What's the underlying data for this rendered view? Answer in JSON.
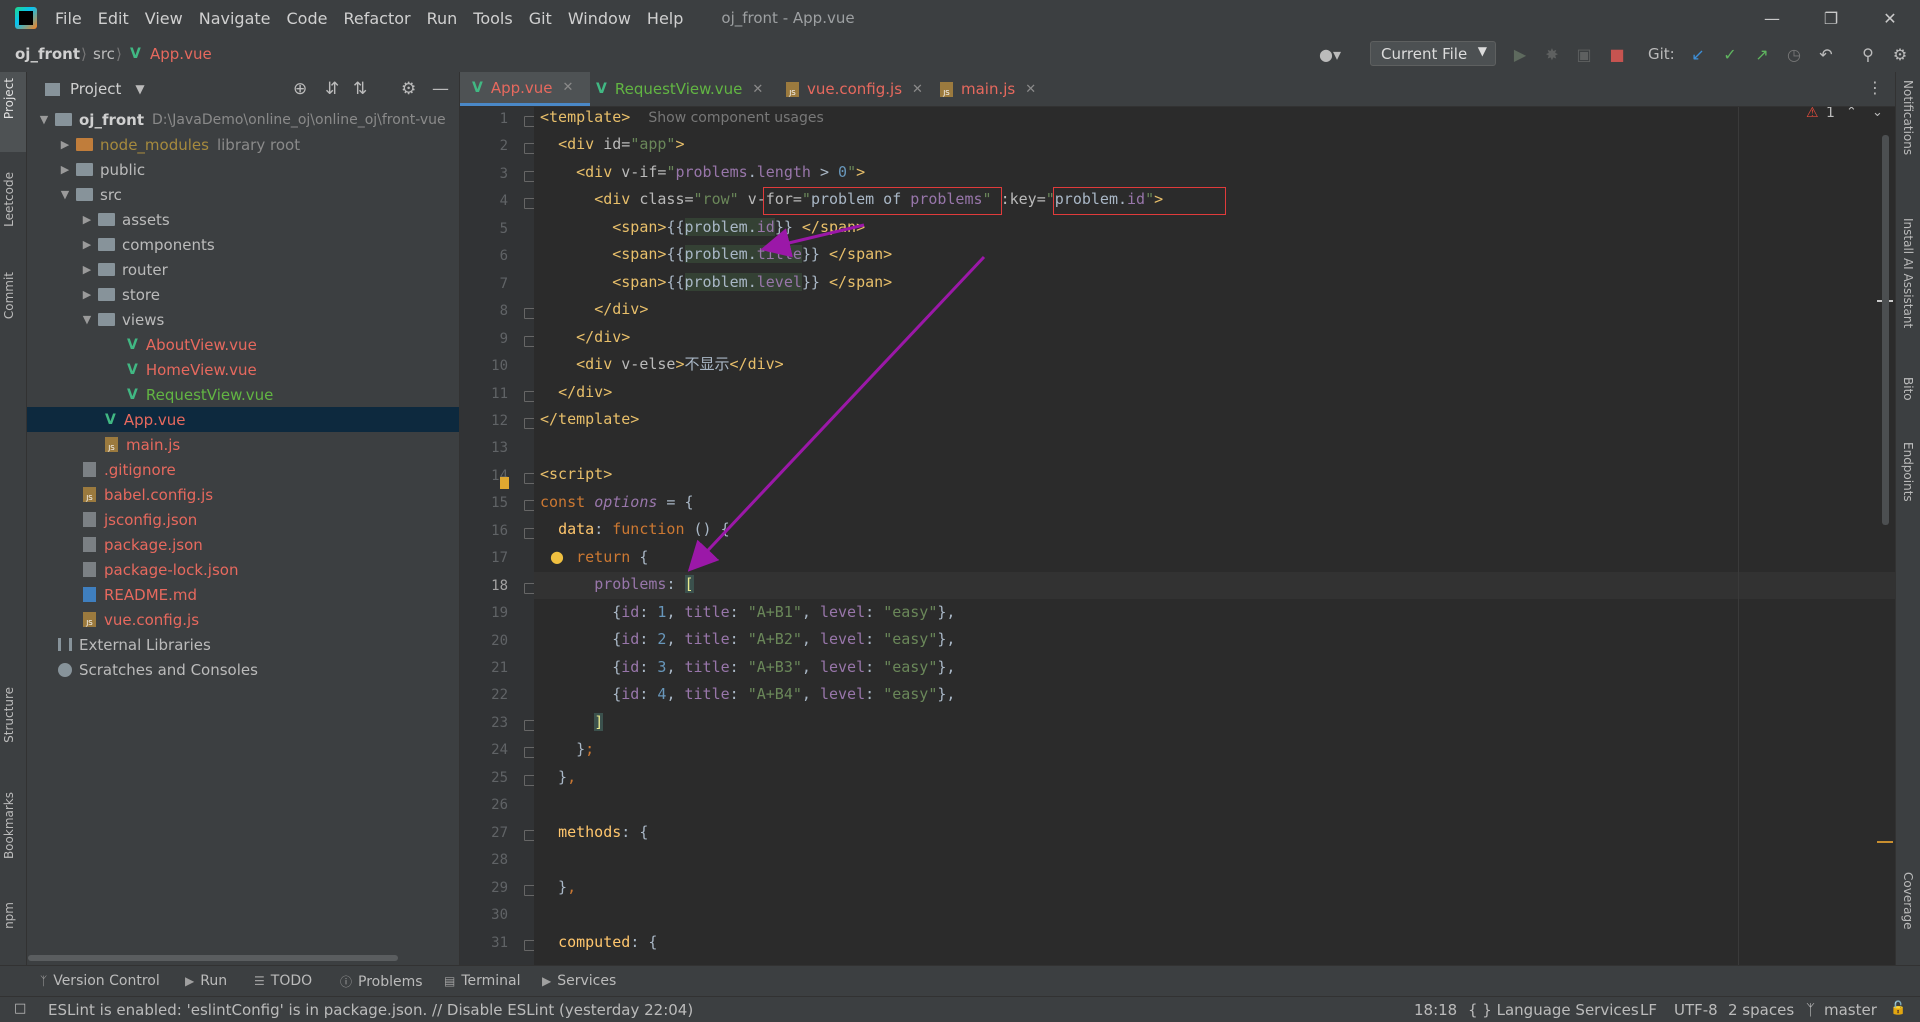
{
  "menu": [
    "File",
    "Edit",
    "View",
    "Navigate",
    "Code",
    "Refactor",
    "Run",
    "Tools",
    "Git",
    "Window",
    "Help"
  ],
  "window_title": "oj_front - App.vue",
  "breadcrumb": {
    "project": "oj_front",
    "folder": "src",
    "file": "App.vue"
  },
  "toolbar": {
    "run_config": "Current File",
    "git_label": "Git:"
  },
  "left_stripe": [
    "Project",
    "Leetcode",
    "Commit",
    "Structure",
    "Bookmarks",
    "npm"
  ],
  "right_stripe": [
    "Notifications",
    "Install AI Assistant",
    "Bito",
    "Endpoints",
    "Coverage"
  ],
  "project_panel": {
    "title": "Project",
    "tree": [
      {
        "label": "oj_front",
        "extra": "D:\\JavaDemo\\online_oj\\online_oj\\front-vue",
        "kind": "root"
      },
      {
        "label": "node_modules",
        "extra": "library root",
        "kind": "folder-lib"
      },
      {
        "label": "public",
        "kind": "folder"
      },
      {
        "label": "src",
        "kind": "folder-open"
      },
      {
        "label": "assets",
        "kind": "folder"
      },
      {
        "label": "components",
        "kind": "folder"
      },
      {
        "label": "router",
        "kind": "folder"
      },
      {
        "label": "store",
        "kind": "folder"
      },
      {
        "label": "views",
        "kind": "folder-open"
      },
      {
        "label": "AboutView.vue",
        "kind": "vue-red"
      },
      {
        "label": "HomeView.vue",
        "kind": "vue-red"
      },
      {
        "label": "RequestView.vue",
        "kind": "vue-green"
      },
      {
        "label": "App.vue",
        "kind": "vue-red-selected"
      },
      {
        "label": "main.js",
        "kind": "js-red"
      },
      {
        "label": ".gitignore",
        "kind": "gen-red"
      },
      {
        "label": "babel.config.js",
        "kind": "js-red"
      },
      {
        "label": "jsconfig.json",
        "kind": "gen-red"
      },
      {
        "label": "package.json",
        "kind": "gen-red"
      },
      {
        "label": "package-lock.json",
        "kind": "gen-red"
      },
      {
        "label": "README.md",
        "kind": "md-red"
      },
      {
        "label": "vue.config.js",
        "kind": "js-red"
      },
      {
        "label": "External Libraries",
        "kind": "lib"
      },
      {
        "label": "Scratches and Consoles",
        "kind": "scratch"
      }
    ]
  },
  "editor_tabs": [
    {
      "label": "App.vue",
      "active": true
    },
    {
      "label": "RequestView.vue",
      "active": false
    },
    {
      "label": "vue.config.js",
      "active": false
    },
    {
      "label": "main.js",
      "active": false
    }
  ],
  "editor": {
    "inspection_count": "1",
    "component_hint": "Show component usages",
    "line_numbers": [
      "1",
      "2",
      "3",
      "4",
      "5",
      "6",
      "7",
      "8",
      "9",
      "10",
      "11",
      "12",
      "13",
      "14",
      "15",
      "16",
      "17",
      "18",
      "19",
      "20",
      "21",
      "22",
      "23",
      "24",
      "25",
      "26",
      "27",
      "28",
      "29",
      "30",
      "31"
    ],
    "current_line": "18"
  },
  "tool_tabs": [
    "Version Control",
    "Run",
    "TODO",
    "Problems",
    "Terminal",
    "Services"
  ],
  "status": {
    "message": "ESLint is enabled: 'eslintConfig' is in package.json. // Disable ESLint (yesterday 22:04)",
    "position": "18:18",
    "lang_services": "{ } Language Services",
    "line_sep": "LF",
    "encoding": "UTF-8",
    "indent": "2 spaces",
    "branch": "master"
  },
  "colors": {
    "accent": "#4a88c7",
    "vue": "#41b883",
    "annotation": "#e03b3b",
    "arrow": "#9b18a8"
  }
}
